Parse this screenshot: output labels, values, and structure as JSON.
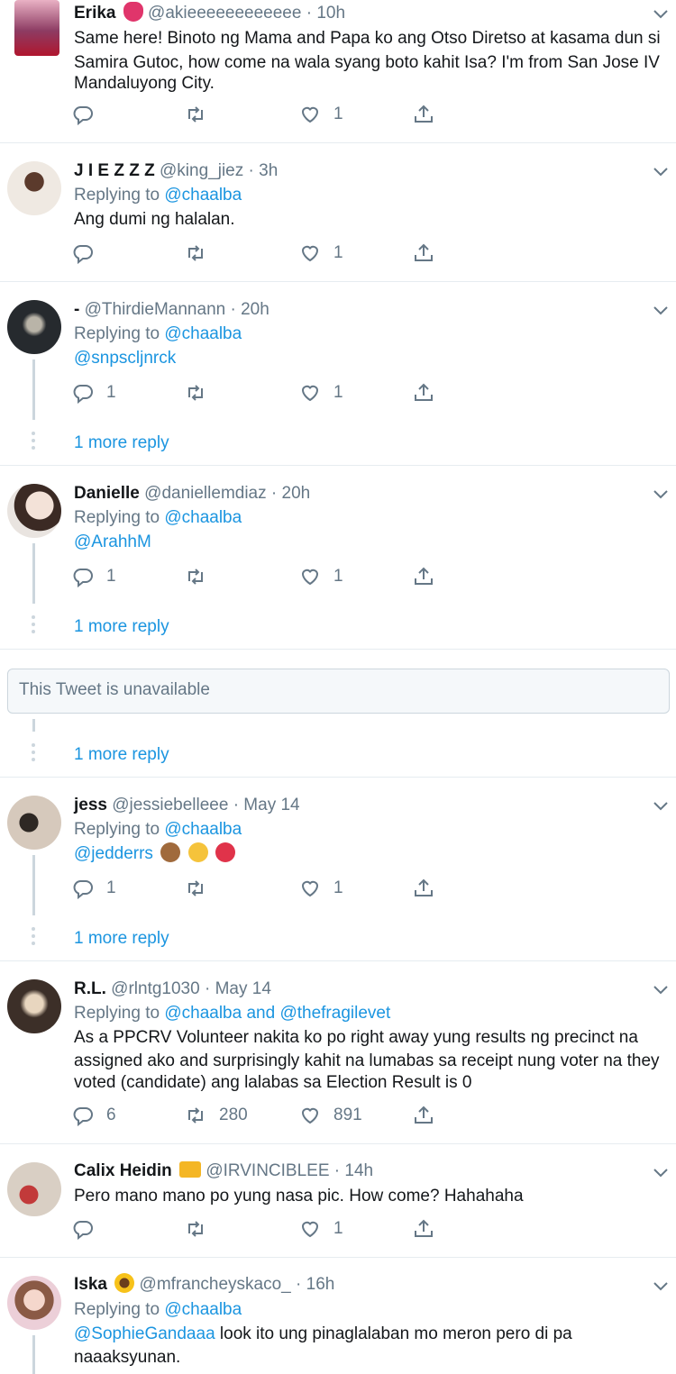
{
  "tweets": [
    {
      "name": "Erika",
      "handle": "@akieeeeeeeeeeee",
      "time": "· 10h",
      "text_lines": [
        "Same here! Binoto ng Mama and Papa ko ang Otso Diretso at kasama dun si",
        "Samira Gutoc, how come na wala syang boto kahit Isa? I'm from San Jose IV",
        "Mandaluyong City."
      ],
      "reply_count": "",
      "retweet_count": "",
      "like_count": "1"
    },
    {
      "name": "J I E Z Z Z",
      "handle": "@king_jiez",
      "time": "· 3h",
      "replying_prefix": "Replying to",
      "replying_to": "@chaalba",
      "text": "Ang dumi ng halalan.",
      "reply_count": "",
      "retweet_count": "",
      "like_count": "1"
    },
    {
      "name": "-",
      "handle": "@ThirdieMannann",
      "time": "· 20h",
      "replying_prefix": "Replying to",
      "replying_to": "@chaalba",
      "text": "@snpscljnrck",
      "reply_count": "1",
      "retweet_count": "",
      "like_count": "1",
      "more_reply": "1 more reply"
    },
    {
      "name": "Danielle",
      "handle": "@daniellemdiaz",
      "time": "· 20h",
      "replying_prefix": "Replying to",
      "replying_to": "@chaalba",
      "text": "@ArahhM",
      "reply_count": "1",
      "retweet_count": "",
      "like_count": "1",
      "more_reply": "1 more reply"
    },
    {
      "unavailable_text": "This Tweet is unavailable",
      "more_reply": "1 more reply"
    },
    {
      "name": "jess",
      "handle": "@jessiebelleee",
      "time": "· May 14",
      "replying_prefix": "Replying to",
      "replying_to": "@chaalba",
      "text": "@jedderrs",
      "reply_count": "1",
      "retweet_count": "",
      "like_count": "1",
      "more_reply": "1 more reply"
    },
    {
      "name": "R.L.",
      "handle": "@rlntg1030",
      "time": "· May 14",
      "replying_prefix": "Replying to",
      "replying_to": "@chaalba and @thefragilevet",
      "text_lines": [
        "As a PPCRV Volunteer nakita ko po right away yung results ng precinct na",
        "assigned ako and surprisingly kahit na lumabas sa receipt nung voter na they",
        "voted (candidate) ang lalabas sa Election Result is 0"
      ],
      "reply_count": "6",
      "retweet_count": "280",
      "like_count": "891"
    },
    {
      "name": "Calix Heidin",
      "handle": "@IRVINCIBLEE",
      "time": "· 14h",
      "text": "Pero mano mano po yung nasa pic. How come? Hahahaha",
      "reply_count": "",
      "retweet_count": "",
      "like_count": "1"
    },
    {
      "name": "Iska",
      "handle": "@mfrancheyskaco_",
      "time": "· 16h",
      "replying_prefix": "Replying to",
      "replying_to": "@chaalba",
      "text_mention": "@SophieGandaaa",
      "text_rest": " look ito ung pinaglalaban mo meron pero di pa",
      "text_line2": "naaaksyunan."
    }
  ],
  "icons": {
    "reply": "reply-icon",
    "retweet": "retweet-icon",
    "like": "heart-icon",
    "share": "share-icon",
    "caret": "chevron-down-icon"
  },
  "colors": {
    "link": "#1b95e0",
    "muted": "#657786",
    "border": "#e6ecf0"
  }
}
